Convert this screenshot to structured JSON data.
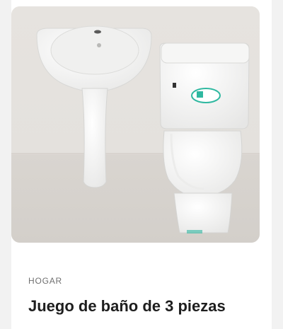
{
  "product": {
    "category": "HOGAR",
    "title": "Juego de baño de 3 piezas",
    "image_icon": "bathroom-set-photo"
  },
  "colors": {
    "background": "#f2f2f2",
    "card": "#ffffff",
    "category_text": "#6f6f6f",
    "title_text": "#1e1e1e",
    "photo_wall": "#e9e7e4",
    "porcelain": "#f7f7f6",
    "sticker": "#2fb8a0"
  }
}
